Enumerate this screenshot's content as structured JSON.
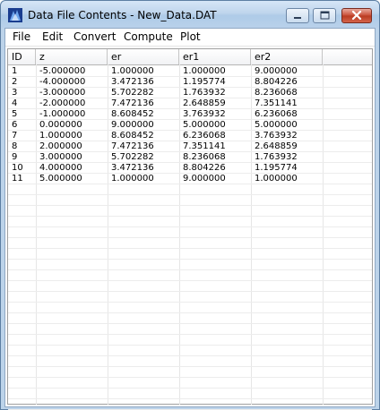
{
  "window": {
    "title": "Data File Contents - New_Data.DAT"
  },
  "menu": {
    "items": [
      "File",
      "Edit",
      "Convert",
      "Compute",
      "Plot"
    ]
  },
  "table": {
    "columns": [
      "ID",
      "z",
      "er",
      "er1",
      "er2"
    ],
    "rows": [
      [
        "1",
        "-5.000000",
        "1.000000",
        "1.000000",
        "9.000000"
      ],
      [
        "2",
        "-4.000000",
        "3.472136",
        "1.195774",
        "8.804226"
      ],
      [
        "3",
        "-3.000000",
        "5.702282",
        "1.763932",
        "8.236068"
      ],
      [
        "4",
        "-2.000000",
        "7.472136",
        "2.648859",
        "7.351141"
      ],
      [
        "5",
        "-1.000000",
        "8.608452",
        "3.763932",
        "6.236068"
      ],
      [
        "6",
        "0.000000",
        "9.000000",
        "5.000000",
        "5.000000"
      ],
      [
        "7",
        "1.000000",
        "8.608452",
        "6.236068",
        "3.763932"
      ],
      [
        "8",
        "2.000000",
        "7.472136",
        "7.351141",
        "2.648859"
      ],
      [
        "9",
        "3.000000",
        "5.702282",
        "8.236068",
        "1.763932"
      ],
      [
        "10",
        "4.000000",
        "3.472136",
        "8.804226",
        "1.195774"
      ],
      [
        "11",
        "5.000000",
        "1.000000",
        "9.000000",
        "1.000000"
      ]
    ]
  }
}
